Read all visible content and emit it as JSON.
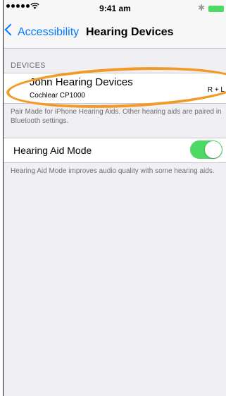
{
  "status_bar": {
    "time": "9:41 am",
    "signal_dots": 5,
    "wifi_icon": "wifi-icon",
    "bluetooth_icon": "bluetooth-icon",
    "battery_icon": "battery-icon"
  },
  "nav": {
    "back_label": "Accessibility",
    "title": "Hearing Devices"
  },
  "devices_section": {
    "header": "DEVICES",
    "device": {
      "name": "John Hearing Devices",
      "model": "Cochlear CP1000",
      "ears": "R + L"
    },
    "footer": "Pair Made for iPhone Hearing Aids. Other hearing aids are paired in Bluetooth settings."
  },
  "hearing_aid_mode": {
    "label": "Hearing Aid Mode",
    "enabled": true,
    "footer": "Hearing Aid Mode improves audio quality with some hearing aids."
  },
  "colors": {
    "accent": "#007aff",
    "toggle_on": "#4cd964",
    "highlight": "#f29a26",
    "background": "#efeff4"
  }
}
